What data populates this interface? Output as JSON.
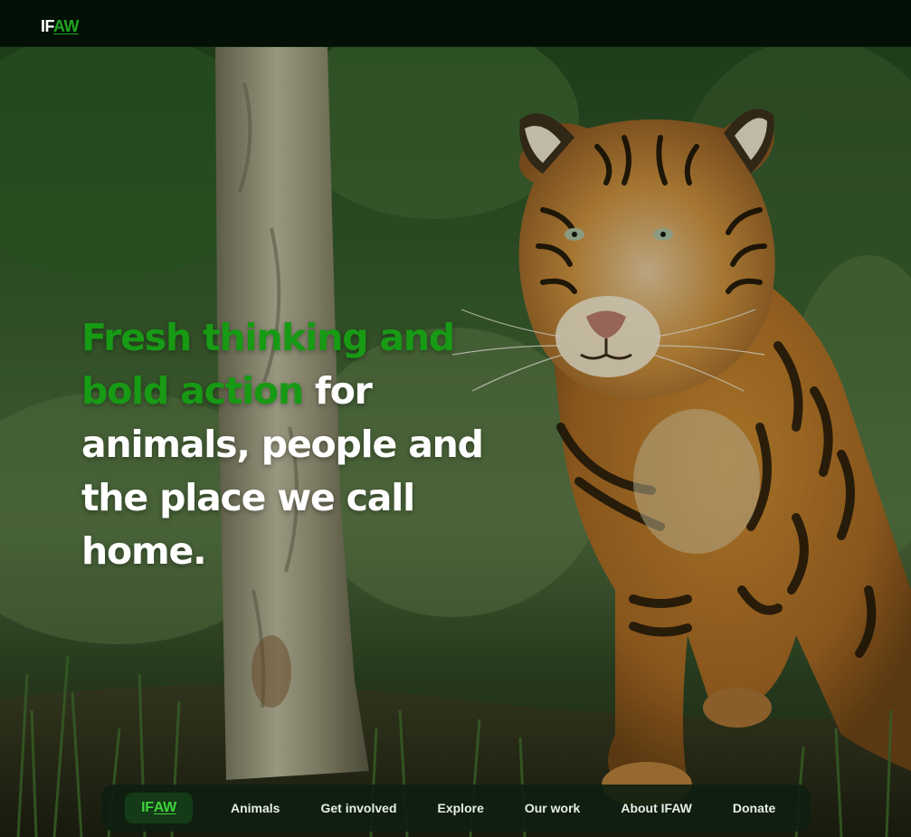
{
  "header": {
    "logo_prefix": "IF",
    "logo_suffix": "AW"
  },
  "hero": {
    "headline_accent_line1": "Fresh thinking and",
    "headline_accent_line2": "bold action",
    "headline_rest_line2": " for",
    "headline_line3": "animals, people and",
    "headline_line4": "the place we call",
    "headline_line5": "home.",
    "image_subject": "tiger-in-forest"
  },
  "bottom_nav": {
    "logo_prefix": "IF",
    "logo_suffix": "AW",
    "items": [
      {
        "label": "Animals"
      },
      {
        "label": "Get involved"
      },
      {
        "label": "Explore"
      },
      {
        "label": "Our work"
      },
      {
        "label": "About IFAW"
      },
      {
        "label": "Donate"
      }
    ]
  },
  "colors": {
    "accent_green": "#179a14",
    "header_bg": "#021005",
    "nav_bg": "#0e1e10"
  }
}
